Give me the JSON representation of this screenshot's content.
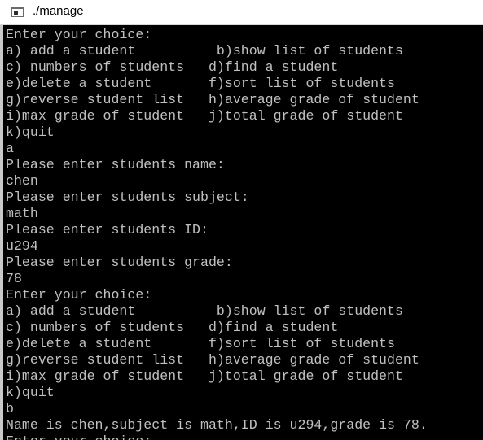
{
  "window": {
    "title": "./manage"
  },
  "console": {
    "lines": [
      "Enter your choice:",
      "a) add a student          b)show list of students",
      "c) numbers of students   d)find a student",
      "e)delete a student       f)sort list of students",
      "g)reverse student list   h)average grade of student",
      "i)max grade of student   j)total grade of student",
      "k)quit",
      "a",
      "Please enter students name:",
      "chen",
      "Please enter students subject:",
      "math",
      "Please enter students ID:",
      "u294",
      "Please enter students grade:",
      "78",
      "Enter your choice:",
      "a) add a student          b)show list of students",
      "c) numbers of students   d)find a student",
      "e)delete a student       f)sort list of students",
      "g)reverse student list   h)average grade of student",
      "i)max grade of student   j)total grade of student",
      "k)quit",
      "b",
      "Name is chen,subject is math,ID is u294,grade is 78.",
      "Enter your choice:"
    ]
  }
}
